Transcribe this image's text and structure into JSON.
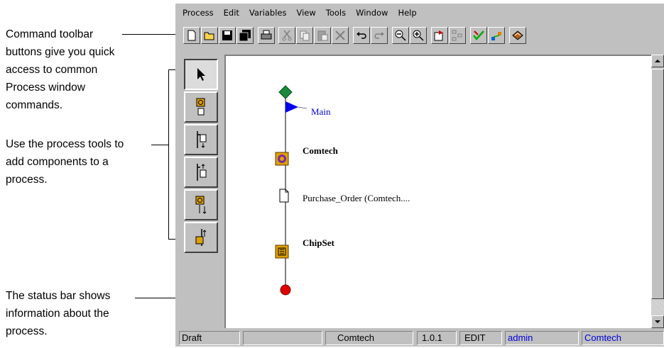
{
  "annotations": {
    "toolbar_note": "Command toolbar\nbuttons give you quick\naccess to common\nProcess window\ncommands.",
    "tools_note": "Use the process tools to\nadd components to a\nprocess.",
    "status_note": "The status bar shows\ninformation about the\nprocess."
  },
  "menubar": {
    "items": [
      "Process",
      "Edit",
      "Variables",
      "View",
      "Tools",
      "Window",
      "Help"
    ]
  },
  "toolbar": {
    "buttons": [
      "new-icon",
      "open-icon",
      "save-icon",
      "save-all-icon",
      "print-icon",
      "cut-icon",
      "copy-icon",
      "paste-icon",
      "delete-icon",
      "undo-icon",
      "redo-icon",
      "zoom-out-icon",
      "zoom-in-icon",
      "properties-icon",
      "layout-icon",
      "validate-icon",
      "deploy-icon",
      "book-icon"
    ]
  },
  "palette": {
    "tools": [
      "select-arrow-icon",
      "activity-tool-icon",
      "branch-down-tool-icon",
      "branch-up-tool-icon",
      "subprocess-tool-icon",
      "return-tool-icon"
    ]
  },
  "diagram": {
    "start_label": "Main",
    "node1_label": "Comtech",
    "doc_label": "Purchase_Order (Comtech....",
    "node2_label": "ChipSet",
    "colors": {
      "start": "#1a8a3c",
      "flag": "#0000ee",
      "end": "#dd0000",
      "label_blue": "#0000cc"
    }
  },
  "statusbar": {
    "fields": [
      "Draft",
      "",
      "Comtech",
      "1.0.1",
      "EDIT",
      "admin",
      "Comtech"
    ],
    "highlight_color": "#0000dd"
  }
}
